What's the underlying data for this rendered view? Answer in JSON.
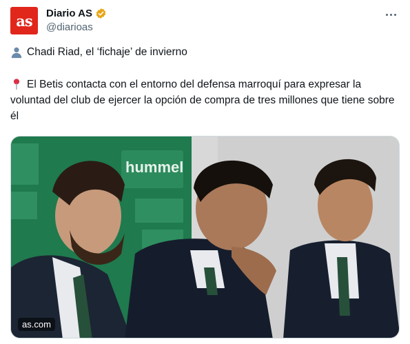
{
  "author": {
    "display_name": "Diario AS",
    "handle": "@diarioas",
    "avatar_text": "as",
    "avatar_color": "#e1261c",
    "verified_color": "#e7a614"
  },
  "tweet": {
    "line1_icon": "person-silhouette-icon",
    "line1": "Chadi Riad, el ‘fichaje’ de invierno",
    "line2_icon": "round-pushpin-icon",
    "line2": "El Betis contacta con el entorno del defensa marroquí para expresar la voluntad del club de ejercer la opción de compra de tres millones que tiene sobre él"
  },
  "media": {
    "source_label": "as.com",
    "backdrop_text": "hummel"
  },
  "menu": {
    "icon": "more-options-icon"
  }
}
